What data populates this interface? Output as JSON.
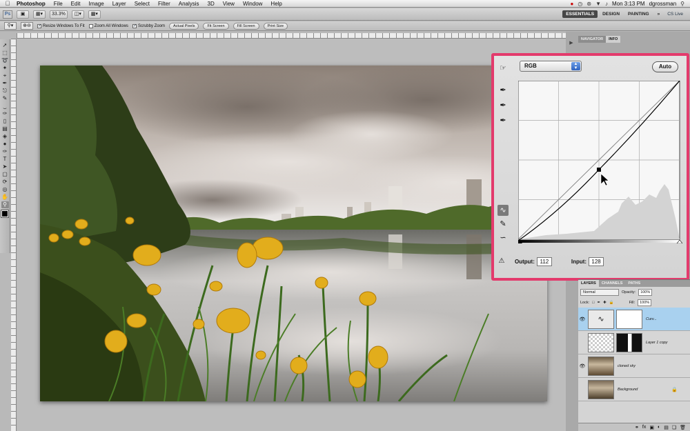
{
  "menubar": {
    "app_name": "Photoshop",
    "items": [
      "File",
      "Edit",
      "Image",
      "Layer",
      "Select",
      "Filter",
      "Analysis",
      "3D",
      "View",
      "Window",
      "Help"
    ],
    "clock": "Mon 3:13 PM",
    "user": "dgrossman"
  },
  "appbar": {
    "logo": "Ps",
    "zoom": "33.3%",
    "workspaces": [
      "ESSENTIALS",
      "DESIGN",
      "PAINTING"
    ],
    "cs_live": "CS Live"
  },
  "options": {
    "checks": [
      {
        "label": "Resize Windows To Fit",
        "checked": true
      },
      {
        "label": "Zoom All Windows",
        "checked": false
      },
      {
        "label": "Scrubby Zoom",
        "checked": true
      }
    ],
    "buttons": [
      "Actual Pixels",
      "Fit Screen",
      "Fill Screen",
      "Print Size"
    ]
  },
  "navigator": {
    "tabs": [
      "NAVIGATOR",
      "INFO"
    ]
  },
  "curves": {
    "channel": "RGB",
    "auto_label": "Auto",
    "output_label": "Output:",
    "output_value": "112",
    "input_label": "Input:",
    "input_value": "128"
  },
  "layers": {
    "tabs": [
      "LAYERS",
      "CHANNELS",
      "PATHS"
    ],
    "blend_mode": "Normal",
    "opacity_label": "Opacity:",
    "opacity": "100%",
    "lock_label": "Lock:",
    "fill_label": "Fill:",
    "fill": "100%",
    "items": [
      {
        "name": "Curv...",
        "selected": true,
        "visible": true
      },
      {
        "name": "Layer 1 copy",
        "selected": false,
        "visible": false
      },
      {
        "name": "cloned sky",
        "selected": false,
        "visible": true
      },
      {
        "name": "Background",
        "selected": false,
        "visible": false
      }
    ]
  },
  "colors": {
    "highlight": "#e33a6c",
    "selected_layer": "#a9d1ef"
  }
}
